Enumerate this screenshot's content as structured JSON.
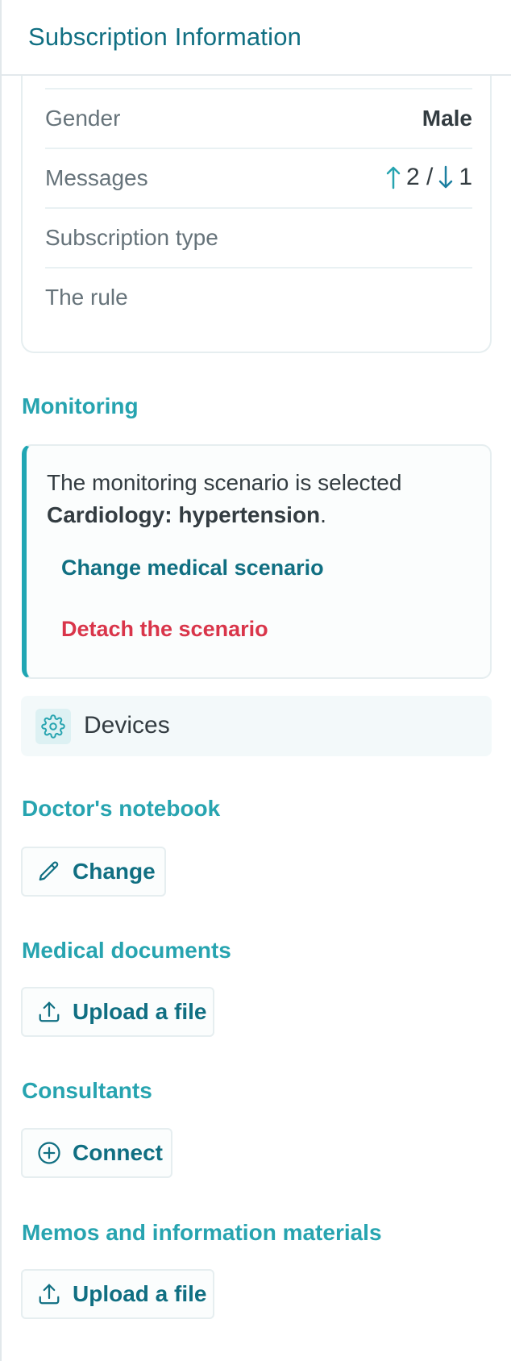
{
  "header": {
    "title": "Subscription Information"
  },
  "info": {
    "gender_label": "Gender",
    "gender_value": "Male",
    "messages_label": "Messages",
    "messages_out": "2 /",
    "messages_in": "1",
    "subscription_type_label": "Subscription type",
    "rule_label": "The rule"
  },
  "monitoring": {
    "title": "Monitoring",
    "scenario_prefix": "The monitoring scenario is selected",
    "scenario_name": "Cardiology: hypertension",
    "scenario_suffix": ".",
    "change_link": "Change medical scenario",
    "detach_link": "Detach the scenario"
  },
  "devices": {
    "label": "Devices",
    "icon": "gear-icon"
  },
  "notebook": {
    "title": "Doctor's notebook",
    "button": "Change",
    "icon": "pencil-icon"
  },
  "medical_documents": {
    "title": "Medical documents",
    "button": "Upload a file",
    "icon": "upload-icon"
  },
  "consultants": {
    "title": "Consultants",
    "button": "Connect",
    "icon": "plus-circle-icon"
  },
  "memos": {
    "title": "Memos and information materials",
    "button": "Upload a file",
    "icon": "upload-icon"
  },
  "colors": {
    "accent": "#27a4b0",
    "link": "#106f82",
    "danger": "#d9354a",
    "text": "#333c41",
    "muted": "#66737a"
  }
}
